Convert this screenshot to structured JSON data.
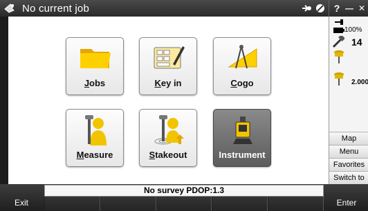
{
  "titlebar": {
    "title": "No current job",
    "help_label": "?",
    "minimize_label": "—",
    "close_label": "✕"
  },
  "tiles": [
    {
      "label_u": "J",
      "label_rest": "obs",
      "icon": "folder-icon"
    },
    {
      "label_u": "K",
      "label_rest": "ey in",
      "icon": "keyin-icon"
    },
    {
      "label_u": "C",
      "label_rest": "ogo",
      "icon": "cogo-icon"
    },
    {
      "label_u": "M",
      "label_rest": "easure",
      "icon": "measure-icon"
    },
    {
      "label_u": "S",
      "label_rest": "takeout",
      "icon": "stakeout-icon"
    },
    {
      "label_u": "",
      "label_rest": "Instrument",
      "icon": "instrument-icon"
    }
  ],
  "status_panel": {
    "battery_percent": "100%",
    "satellite_count": "14",
    "antenna_height": "2.000"
  },
  "side_buttons": [
    {
      "label": "Map"
    },
    {
      "label": "Menu"
    },
    {
      "label": "Favorites"
    },
    {
      "label": "Switch to"
    }
  ],
  "statusbar": {
    "text": "No survey  PDOP:1.3"
  },
  "softkeys": {
    "exit_label": "Exit",
    "enter_label": "Enter"
  },
  "colors": {
    "folder": "#f6c700",
    "person": "#f2c400",
    "titlebar": "#333333",
    "selected_tile": "#6a6a6a"
  }
}
